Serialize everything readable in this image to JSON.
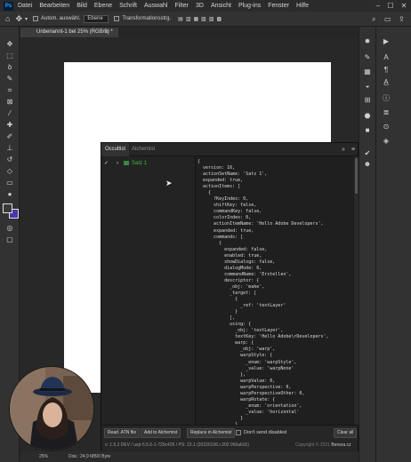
{
  "menubar": {
    "logo": "Ps",
    "items": [
      "Datei",
      "Bearbeiten",
      "Bild",
      "Ebene",
      "Schrift",
      "Auswahl",
      "Filter",
      "3D",
      "Ansicht",
      "Plug-ins",
      "Fenster",
      "Hilfe"
    ]
  },
  "options": {
    "auto_select_label": "Autom. auswähl.",
    "layer_select": "Ebene",
    "transform_label": "Transformationsstrg."
  },
  "document": {
    "tab_title": "Unbenannt-1 bei 25% (RGB/8) *",
    "status_zoom": "25%",
    "status_info": "Dok.: 24,9 MB/0 Byte"
  },
  "alchemist": {
    "tabs": [
      "Occultist",
      "Alchemist"
    ],
    "tree": {
      "check": "✓",
      "caret": "›",
      "label": "Satz 1"
    },
    "code": "{\n  version: 16,\n  actionSetName: 'Satz 1',\n  expanded: true,\n  actionItems: [\n    {\n      ?KeyIndex: 0,\n      shiftKey: false,\n      commandKey: false,\n      colorIndex: 0,\n      actionItemName: 'Hello Adobe Developers',\n      expanded: true,\n      commands: [\n        {\n          expanded: false,\n          enabled: true,\n          showDialogs: false,\n          dialogMode: 0,\n          commandName: 'Erstellen',\n          descriptor: {\n            _obj: 'make',\n            _target: [\n              {\n                _ref: 'textLayer'\n              }\n            ],\n            using: {\n              _obj: 'textLayer',\n              textKey: 'Hello Adobe\\rDevelopers',\n              warp: {\n                _obj: 'warp',\n                warpStyle: {\n                  _enum: 'warpStyle',\n                  _value: 'warpNone'\n                },\n                warpValue: 0,\n                warpPerspective: 0,\n                warpPerspectiveOther: 0,\n                warpRotate: {\n                  _enum: 'orientation',\n                  _value: 'horizontal'\n                }\n              },\n              textClickPoint: {\n                _obj: 'paint',",
    "buttons": {
      "read": "Read .ATN file",
      "add": "Add to Alchemist",
      "replace": "Replace in Alchemist",
      "clear": "Clear all"
    },
    "dont_send_label": "Don't send disabled",
    "version": "v: 1.5.2 DEV / uxp-5.5.6-1-720c425 / PS: 23.1 (20220106.r.202 060a6d1)",
    "copyright": "Copyright © 2021",
    "brand": "Bereza.cz"
  }
}
